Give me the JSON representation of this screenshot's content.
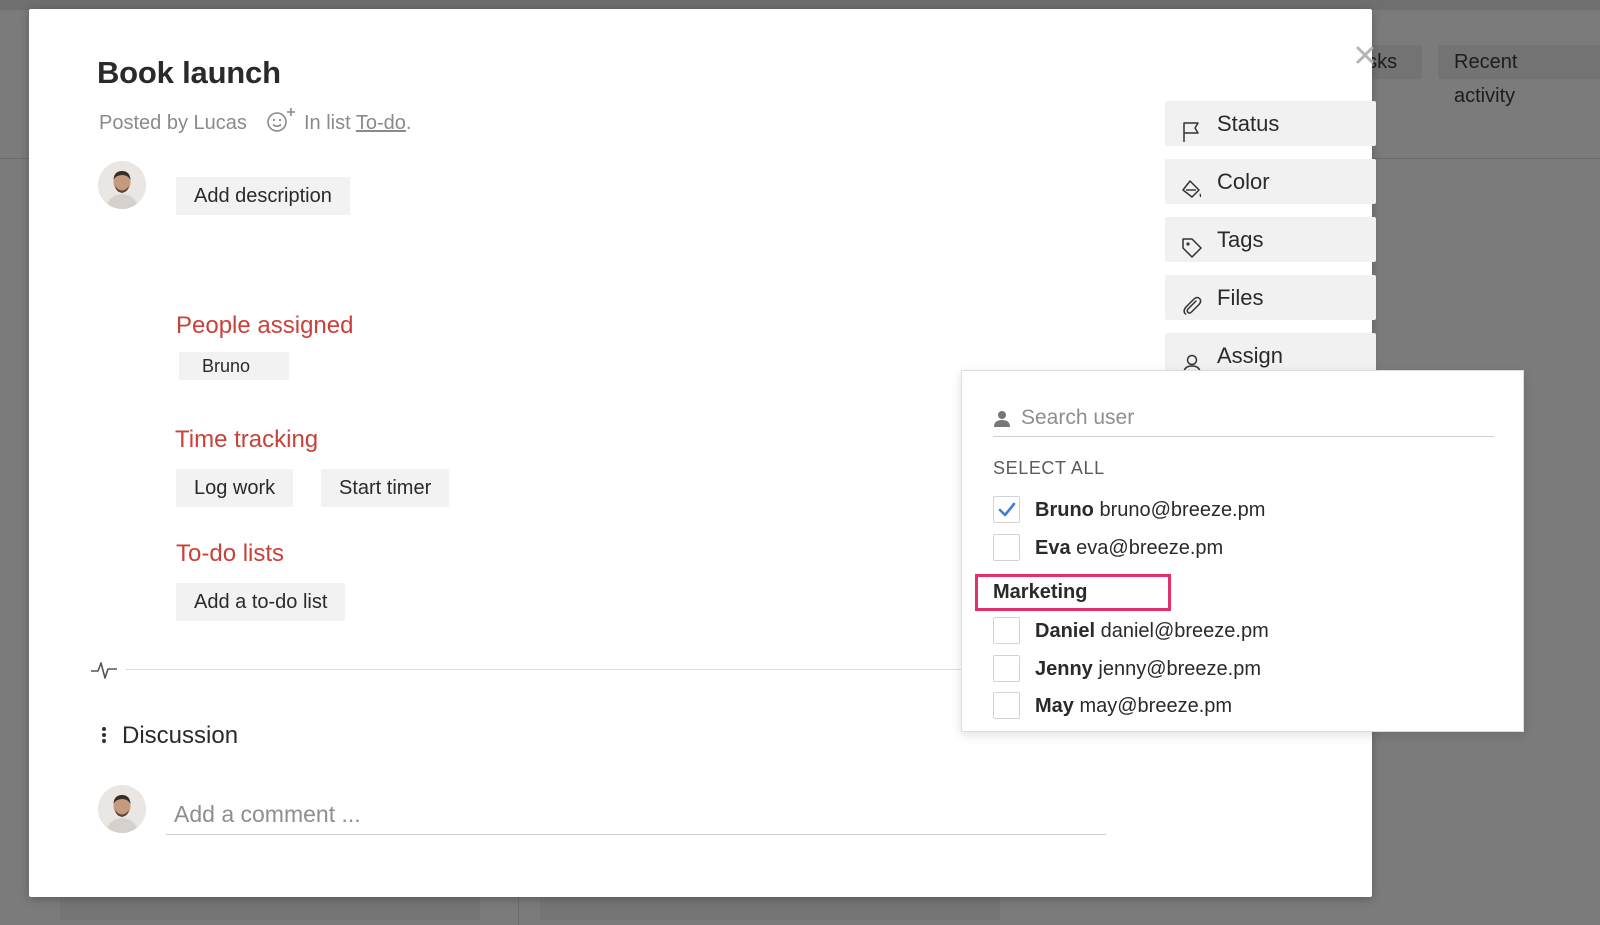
{
  "background": {
    "tabs": [
      "asks",
      "Recent activity"
    ]
  },
  "task": {
    "title": "Book launch",
    "posted_by": "Posted by Lucas",
    "in_list_prefix": "In list",
    "list_name": "To-do",
    "list_suffix": ".",
    "add_description": "Add description",
    "people_assigned_title": "People assigned",
    "assigned_people": [
      "Bruno"
    ],
    "time_tracking_title": "Time tracking",
    "log_work": "Log work",
    "start_timer": "Start timer",
    "todo_lists_title": "To-do lists",
    "add_todo_list": "Add a to-do list",
    "discussion_title": "Discussion",
    "comment_placeholder": "Add a comment ..."
  },
  "actions": {
    "status": "Status",
    "color": "Color",
    "tags": "Tags",
    "files": "Files",
    "assign": "Assign"
  },
  "assign_dropdown": {
    "search_placeholder": "Search user",
    "select_all": "SELECT ALL",
    "users": [
      {
        "name": "Bruno",
        "email": "bruno@breeze.pm",
        "checked": true
      },
      {
        "name": "Eva",
        "email": "eva@breeze.pm",
        "checked": false
      }
    ],
    "group": {
      "name": "Marketing",
      "users": [
        {
          "name": "Daniel",
          "email": "daniel@breeze.pm",
          "checked": false
        },
        {
          "name": "Jenny",
          "email": "jenny@breeze.pm",
          "checked": false
        },
        {
          "name": "May",
          "email": "may@breeze.pm",
          "checked": false
        }
      ]
    }
  },
  "colors": {
    "section_title": "#c9413a",
    "highlight_border": "#e2306c",
    "checkmark": "#3b7fd9"
  }
}
